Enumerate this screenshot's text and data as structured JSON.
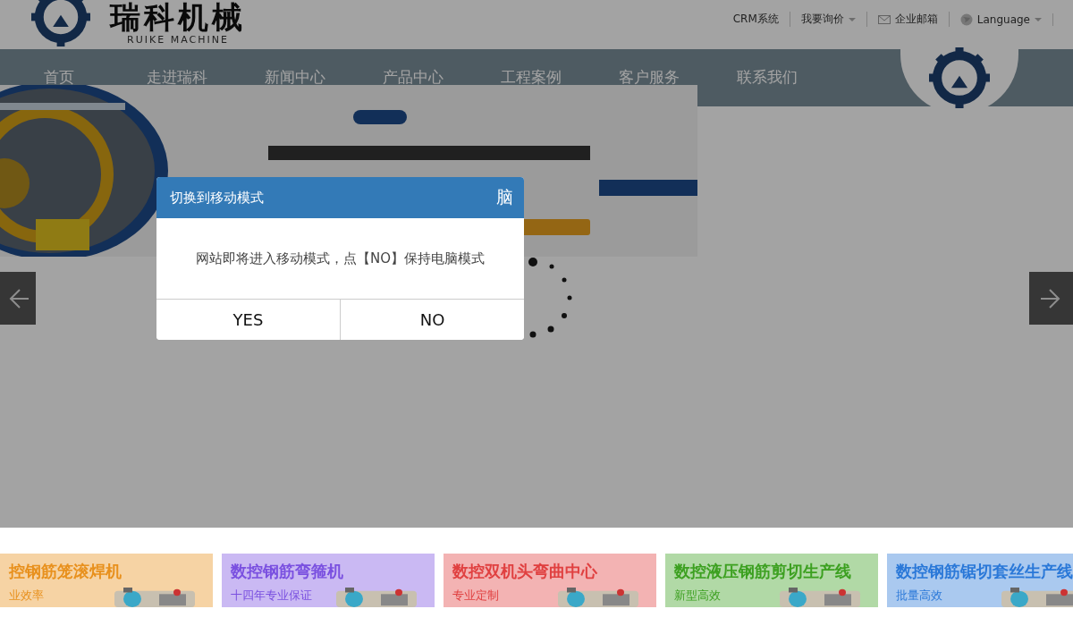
{
  "header": {
    "logo_text": "瑞科机械",
    "logo_subtext": "RUIKE MACHINE",
    "top_links": [
      {
        "label": "CRM系统",
        "kind": "plain"
      },
      {
        "label": "我要询价",
        "kind": "dropdown"
      },
      {
        "label": "企业邮箱",
        "kind": "mail"
      },
      {
        "label": "Language",
        "kind": "globe"
      }
    ]
  },
  "nav": {
    "items": [
      "首页",
      "走进瑞科",
      "新闻中心",
      "产品中心",
      "工程案例",
      "客户服务",
      "联系我们"
    ]
  },
  "dialog": {
    "title": "切换到移动模式",
    "close": "脑",
    "message": "网站即将进入移动模式，点【NO】保持电脑模式",
    "buttons": [
      "YES",
      "NO"
    ]
  },
  "products": [
    {
      "title": "控钢筋笼滚焊机",
      "subtitle": "业效率",
      "color": "#e8901c"
    },
    {
      "title": "数控钢筋弯箍机",
      "subtitle": "十四年专业保证",
      "color": "#7a50e0"
    },
    {
      "title": "数控双机头弯曲中心",
      "subtitle": "专业定制",
      "color": "#e04040"
    },
    {
      "title": "数控液压钢筋剪切生产线",
      "subtitle": "新型高效",
      "color": "#3ca020"
    },
    {
      "title": "数控钢筋锯切套丝生产线",
      "subtitle": "批量高效",
      "color": "#2a78d8"
    }
  ]
}
